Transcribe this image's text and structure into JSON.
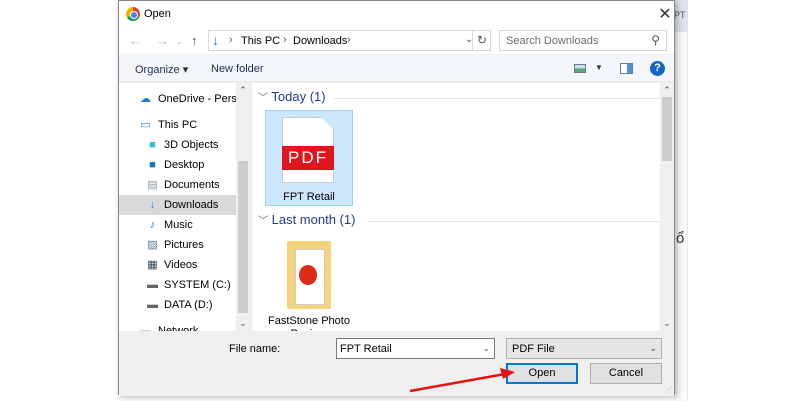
{
  "background": {
    "top_fragment": "PT",
    "char_fragment": "ổ"
  },
  "dialog": {
    "title": "Open",
    "address": {
      "crumbs": [
        "This PC",
        "Downloads"
      ]
    },
    "search_placeholder": "Search Downloads",
    "toolbar": {
      "organize": "Organize ▾",
      "new_folder": "New folder",
      "help": "?"
    },
    "nav_items": [
      {
        "label": "OneDrive - Person",
        "icon": "cloud-icon"
      },
      {
        "label": "This PC",
        "icon": "computer-icon"
      },
      {
        "label": "3D Objects",
        "icon": "cube-icon"
      },
      {
        "label": "Desktop",
        "icon": "desktop-icon"
      },
      {
        "label": "Documents",
        "icon": "document-icon"
      },
      {
        "label": "Downloads",
        "icon": "download-icon",
        "selected": true
      },
      {
        "label": "Music",
        "icon": "music-icon"
      },
      {
        "label": "Pictures",
        "icon": "pictures-icon"
      },
      {
        "label": "Videos",
        "icon": "videos-icon"
      },
      {
        "label": "SYSTEM (C:)",
        "icon": "drive-icon"
      },
      {
        "label": "DATA (D:)",
        "icon": "drive-icon"
      },
      {
        "label": "Network",
        "icon": "network-icon"
      }
    ],
    "groups": [
      {
        "label": "Today (1)",
        "files": [
          {
            "name": "FPT Retail",
            "badge": "PDF",
            "selected": true
          }
        ]
      },
      {
        "label": "Last month (1)",
        "files": [
          {
            "name": "FastStone Photo Resizer"
          }
        ]
      }
    ],
    "file_name_label": "File name:",
    "file_name_value": "FPT Retail",
    "file_type": "PDF File",
    "open_button": "Open",
    "cancel_button": "Cancel"
  },
  "colors": {
    "annotation_arrow": "#e81010",
    "selection": "#cce8ff",
    "pdf_red": "#e0161f"
  }
}
